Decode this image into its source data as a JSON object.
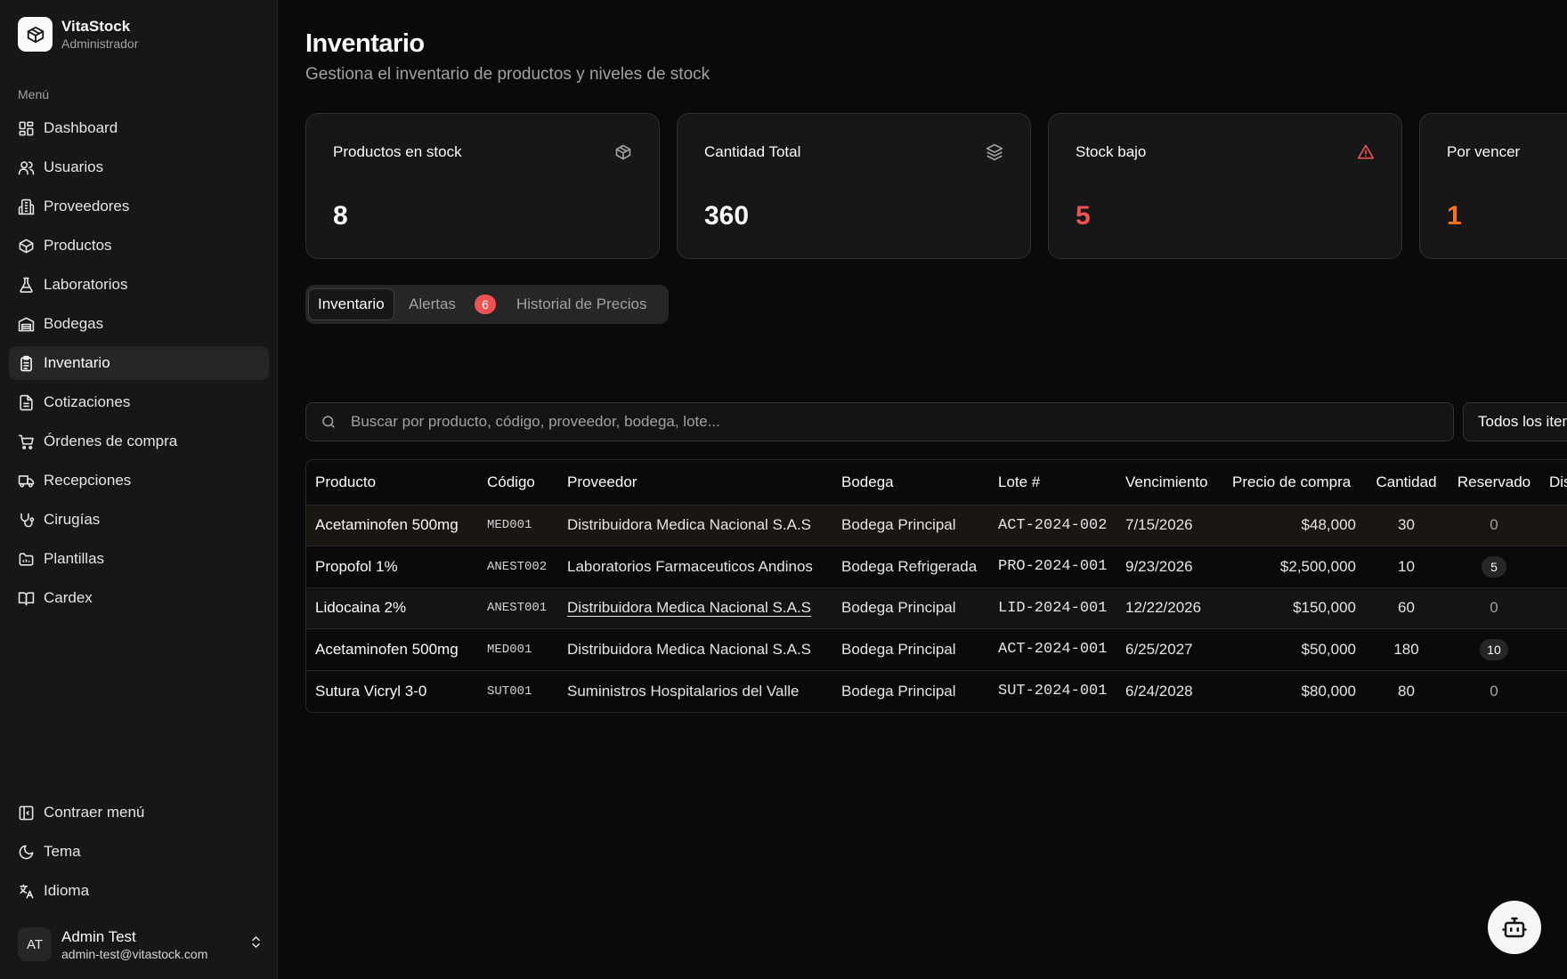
{
  "brand": {
    "name": "VitaStock",
    "role": "Administrador"
  },
  "sidebar": {
    "menu_label": "Menú",
    "items": [
      {
        "label": "Dashboard",
        "icon": "dashboard-icon",
        "active": false
      },
      {
        "label": "Usuarios",
        "icon": "users-icon",
        "active": false
      },
      {
        "label": "Proveedores",
        "icon": "building-icon",
        "active": false
      },
      {
        "label": "Productos",
        "icon": "package-icon",
        "active": false
      },
      {
        "label": "Laboratorios",
        "icon": "flask-icon",
        "active": false
      },
      {
        "label": "Bodegas",
        "icon": "warehouse-icon",
        "active": false
      },
      {
        "label": "Inventario",
        "icon": "clipboard-icon",
        "active": true
      },
      {
        "label": "Cotizaciones",
        "icon": "file-text-icon",
        "active": false
      },
      {
        "label": "Órdenes de compra",
        "icon": "cart-icon",
        "active": false
      },
      {
        "label": "Recepciones",
        "icon": "truck-icon",
        "active": false
      },
      {
        "label": "Cirugías",
        "icon": "stethoscope-icon",
        "active": false
      },
      {
        "label": "Plantillas",
        "icon": "folder-icon",
        "active": false
      },
      {
        "label": "Cardex",
        "icon": "book-icon",
        "active": false
      }
    ],
    "bottom": [
      {
        "label": "Contraer menú",
        "icon": "collapse-icon"
      },
      {
        "label": "Tema",
        "icon": "moon-icon"
      },
      {
        "label": "Idioma",
        "icon": "language-icon"
      }
    ],
    "user": {
      "initials": "AT",
      "name": "Admin Test",
      "email": "admin-test@vitastock.com"
    }
  },
  "header": {
    "title": "Inventario",
    "subtitle": "Gestiona el inventario de productos y niveles de stock"
  },
  "stats": [
    {
      "title": "Productos en stock",
      "value": "8",
      "icon": "package-icon",
      "color": "#fafafa"
    },
    {
      "title": "Cantidad Total",
      "value": "360",
      "icon": "layers-icon",
      "color": "#fafafa"
    },
    {
      "title": "Stock bajo",
      "value": "5",
      "icon": "warning-icon",
      "color": "#f05252"
    },
    {
      "title": "Por vencer",
      "value": "1",
      "icon": "clock-icon",
      "color": "#f97316"
    }
  ],
  "tabs": {
    "inventario": "Inventario",
    "alertas": "Alertas",
    "alertas_count": "6",
    "historial": "Historial de Precios"
  },
  "search": {
    "placeholder": "Buscar por producto, código, proveedor, bodega, lote...",
    "filter_label": "Todos los items"
  },
  "table": {
    "columns": [
      "Producto",
      "Código",
      "Proveedor",
      "Bodega",
      "Lote #",
      "Vencimiento",
      "Precio de compra",
      "Cantidad",
      "Reservado",
      "Disponible"
    ],
    "rows": [
      {
        "product": "Acetaminofen 500mg",
        "code": "MED001",
        "supplier": "Distribuidora Medica Nacional S.A.S",
        "warehouse": "Bodega Principal",
        "lot": "ACT-2024-002",
        "expiry": "7/15/2026",
        "price": "$48,000",
        "qty": "30",
        "reserved": "0"
      },
      {
        "product": "Propofol 1%",
        "code": "ANEST002",
        "supplier": "Laboratorios Farmaceuticos Andinos",
        "warehouse": "Bodega Refrigerada",
        "lot": "PRO-2024-001",
        "expiry": "9/23/2026",
        "price": "$2,500,000",
        "qty": "10",
        "reserved": "5"
      },
      {
        "product": "Lidocaina 2%",
        "code": "ANEST001",
        "supplier": "Distribuidora Medica Nacional S.A.S",
        "warehouse": "Bodega Principal",
        "lot": "LID-2024-001",
        "expiry": "12/22/2026",
        "price": "$150,000",
        "qty": "60",
        "reserved": "0"
      },
      {
        "product": "Acetaminofen 500mg",
        "code": "MED001",
        "supplier": "Distribuidora Medica Nacional S.A.S",
        "warehouse": "Bodega Principal",
        "lot": "ACT-2024-001",
        "expiry": "6/25/2027",
        "price": "$50,000",
        "qty": "180",
        "reserved": "10"
      },
      {
        "product": "Sutura Vicryl 3-0",
        "code": "SUT001",
        "supplier": "Suministros Hospitalarios del Valle",
        "warehouse": "Bodega Principal",
        "lot": "SUT-2024-001",
        "expiry": "6/24/2028",
        "price": "$80,000",
        "qty": "80",
        "reserved": "0"
      }
    ]
  },
  "assistant": {
    "icon": "bot-icon"
  }
}
